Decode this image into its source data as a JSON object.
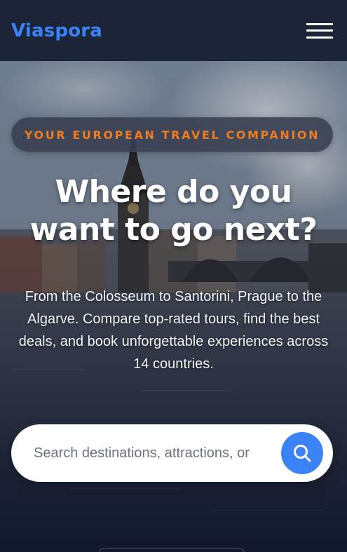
{
  "header": {
    "logo_text": "Viaspora",
    "menu_icon": "hamburger-icon"
  },
  "hero": {
    "tagline": "YOUR EUROPEAN TRAVEL COMPANION",
    "headline": "Where do you want to go next?",
    "subtext": "From the Colosseum to Santorini, Prague to the Algarve. Compare top-rated tours, find the best deals, and book unforgettable experiences across 14 countries."
  },
  "search": {
    "placeholder": "Search destinations, attractions, or g",
    "value": "",
    "button_icon": "search-icon"
  },
  "colors": {
    "brand": "#3b82f6",
    "accent": "#f07c21",
    "header_bg": "#1c2438"
  }
}
